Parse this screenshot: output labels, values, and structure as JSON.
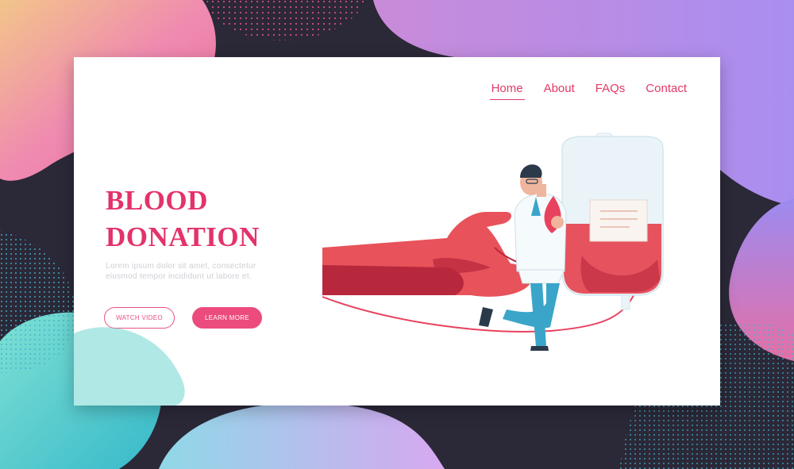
{
  "nav": {
    "items": [
      {
        "label": "Home",
        "active": true
      },
      {
        "label": "About",
        "active": false
      },
      {
        "label": "FAQs",
        "active": false
      },
      {
        "label": "Contact",
        "active": false
      }
    ]
  },
  "hero": {
    "title_line1": "BLOOD",
    "title_line2": "DONATION",
    "lorem_line1": "Lorem ipsum dolor sit amet, consectetur",
    "lorem_line2": "eiusmod tempor incididunt ut labore et.",
    "watch_label": "WATCH VIDEO",
    "learn_label": "LEARN MORE"
  },
  "colors": {
    "accent": "#e3336a",
    "background_dark": "#2b2838",
    "purple": "#b184e8",
    "teal": "#4fd1c5"
  }
}
